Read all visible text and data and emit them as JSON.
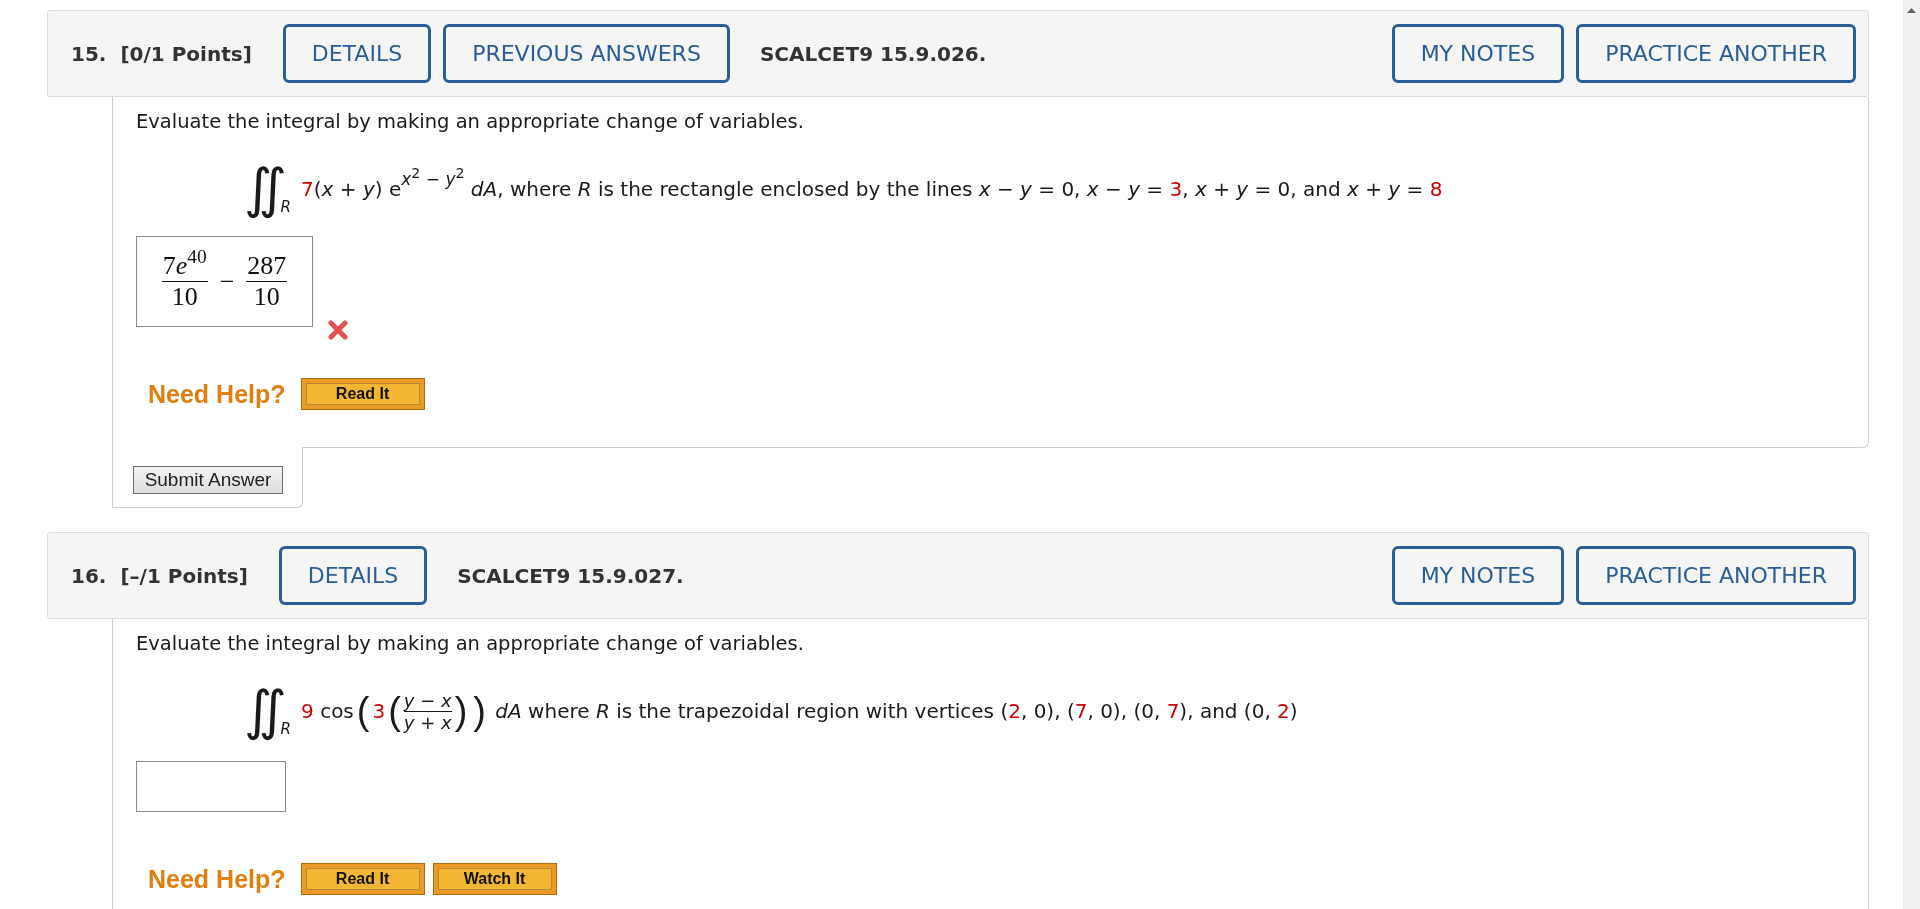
{
  "questions": [
    {
      "number": "15.",
      "points": "[0/1 Points]",
      "left_buttons": [
        "DETAILS",
        "PREVIOUS ANSWERS"
      ],
      "code": "SCALCET9 15.9.026.",
      "right_buttons": [
        "MY NOTES",
        "PRACTICE ANOTHER"
      ],
      "prompt": "Evaluate the integral by making an appropriate change of variables.",
      "formula": [
        {
          "kind": "integral",
          "symbol": "∬",
          "sub": "R"
        },
        {
          "kind": "value",
          "text": "7"
        },
        {
          "kind": "text",
          "text": "(*x* + *y*) e"
        },
        {
          "kind": "sup",
          "text": "*x*$^{2}$ − *y*$^{2}$"
        },
        {
          "kind": "text",
          "text": " *dA*, where *R* is the rectangle enclosed by the lines *x* − *y* = 0, *x* − *y* = "
        },
        {
          "kind": "value",
          "text": "3"
        },
        {
          "kind": "text",
          "text": ", *x* + *y* = 0, and *x* + *y* = "
        },
        {
          "kind": "value",
          "text": "8"
        }
      ],
      "answer": {
        "expression": [
          {
            "kind": "frac",
            "numerator": [
              {
                "kind": "num",
                "text": "7"
              },
              {
                "kind": "var",
                "text": "e"
              },
              {
                "kind": "sup",
                "text": "40"
              }
            ],
            "denominator": [
              {
                "kind": "num",
                "text": "10"
              }
            ]
          },
          {
            "kind": "op",
            "text": "−"
          },
          {
            "kind": "frac",
            "numerator": [
              {
                "kind": "num",
                "text": "287"
              }
            ],
            "denominator": [
              {
                "kind": "num",
                "text": "10"
              }
            ]
          }
        ],
        "correct": false
      },
      "help": {
        "label": "Need Help?",
        "buttons": [
          "Read It"
        ]
      },
      "submit": "Submit Answer"
    },
    {
      "number": "16.",
      "points": "[–/1 Points]",
      "left_buttons": [
        "DETAILS"
      ],
      "code": "SCALCET9 15.9.027.",
      "right_buttons": [
        "MY NOTES",
        "PRACTICE ANOTHER"
      ],
      "prompt": "Evaluate the integral by making an appropriate change of variables.",
      "formula": [
        {
          "kind": "integral",
          "symbol": "∬",
          "sub": "R"
        },
        {
          "kind": "value",
          "text": "9"
        },
        {
          "kind": "text",
          "text": " cos"
        },
        {
          "kind": "paren",
          "text": "("
        },
        {
          "kind": "value",
          "text": "3"
        },
        {
          "kind": "paren",
          "text": "("
        },
        {
          "kind": "frac",
          "numerator": "*y* − *x*",
          "denominator": "*y* + *x*"
        },
        {
          "kind": "paren",
          "text": ")"
        },
        {
          "kind": "paren",
          "text": ")"
        },
        {
          "kind": "text",
          "text": " *dA* where *R* is the trapezoidal region with vertices ("
        },
        {
          "kind": "value",
          "text": "2"
        },
        {
          "kind": "text",
          "text": ", 0), ("
        },
        {
          "kind": "value",
          "text": "7"
        },
        {
          "kind": "text",
          "text": ", 0), (0, "
        },
        {
          "kind": "value",
          "text": "7"
        },
        {
          "kind": "text",
          "text": "), and (0, "
        },
        {
          "kind": "value",
          "text": "2"
        },
        {
          "kind": "text",
          "text": ")"
        }
      ],
      "help": {
        "label": "Need Help?",
        "buttons": [
          "Read It",
          "Watch It"
        ]
      }
    }
  ]
}
